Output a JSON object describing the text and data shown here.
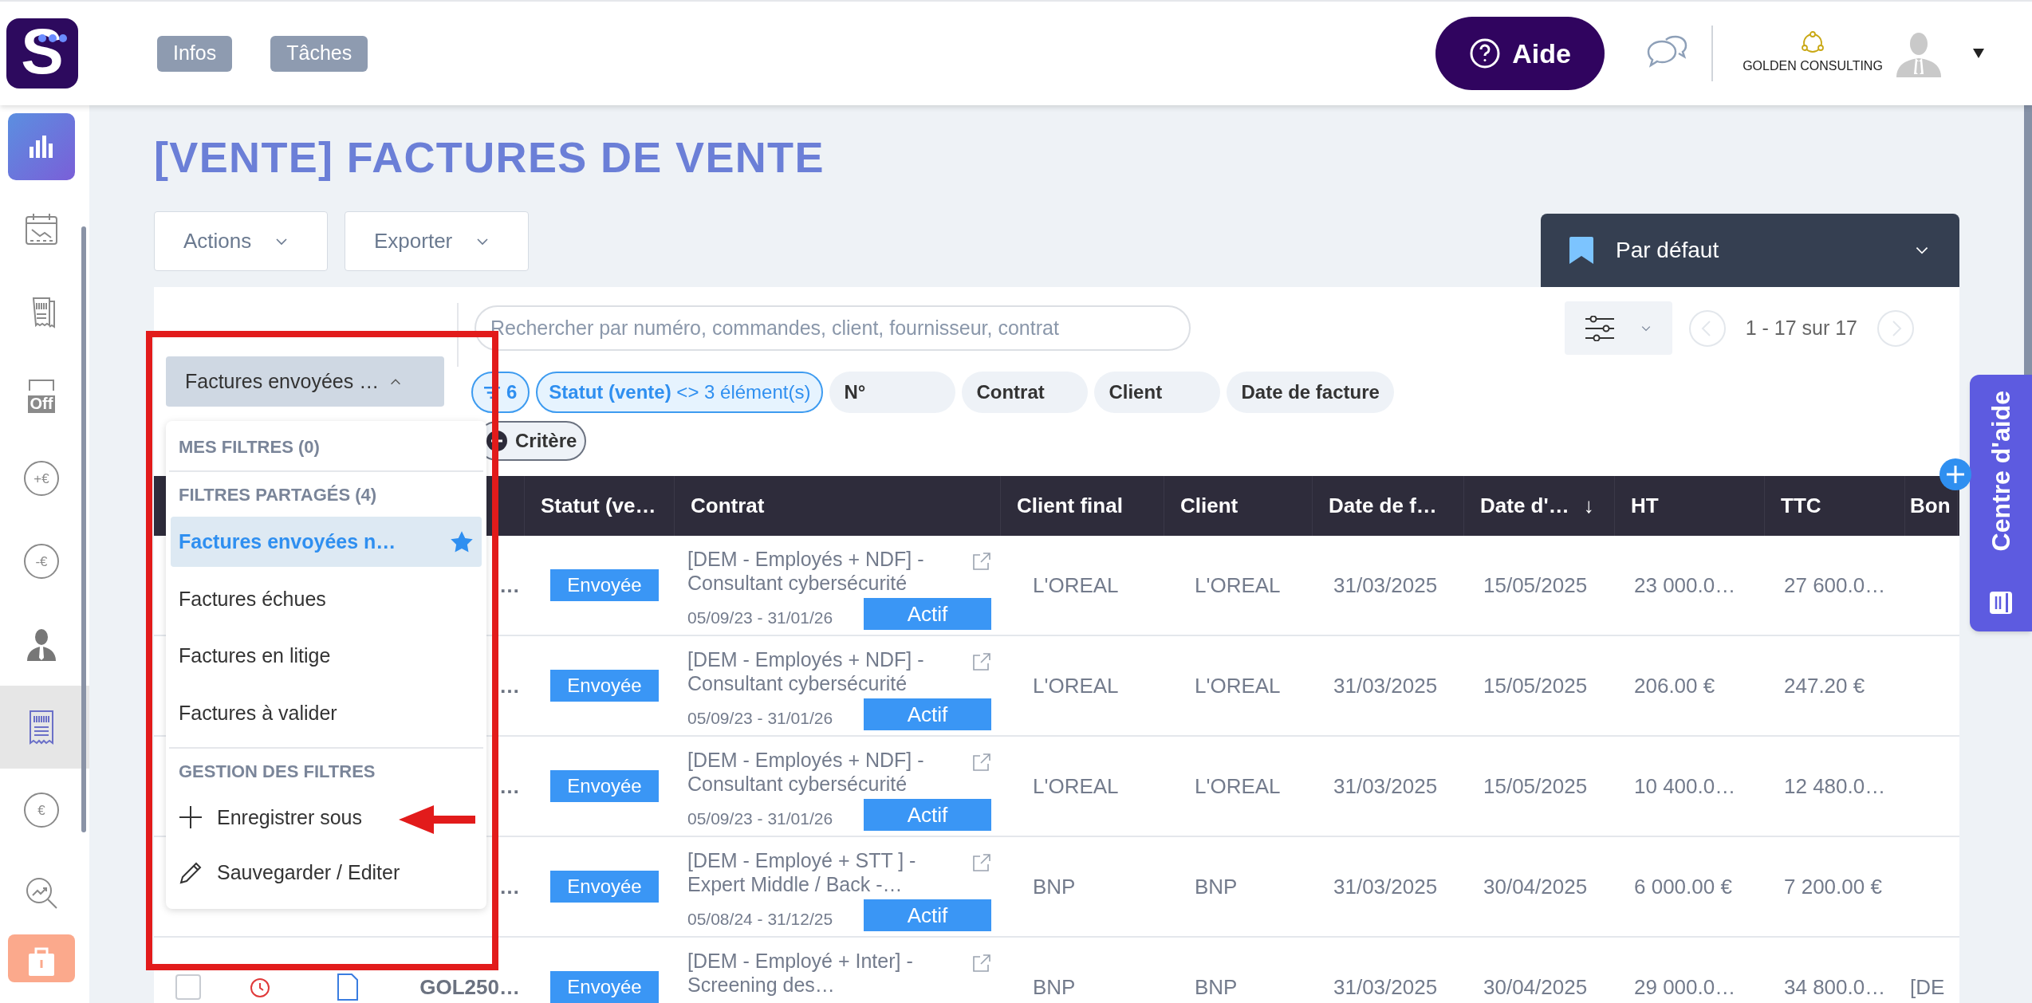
{
  "header": {
    "logo": {
      "letter": "S"
    },
    "nav_buttons": [
      "Infos",
      "Tâches"
    ],
    "help_button": "Aide",
    "company": "GOLDEN CONSULTING"
  },
  "sidebar": {
    "items": [
      {
        "kind": "chart",
        "selected": false
      },
      {
        "kind": "calendar",
        "selected": false
      },
      {
        "kind": "receipts",
        "selected": false
      },
      {
        "kind": "off",
        "label": "Off",
        "selected": false
      },
      {
        "kind": "plus-euro",
        "label": "+€",
        "selected": false
      },
      {
        "kind": "minus-euro",
        "label": "-€",
        "selected": false
      },
      {
        "kind": "person",
        "selected": false
      },
      {
        "kind": "invoice",
        "selected": true
      },
      {
        "kind": "coins",
        "label": "€",
        "selected": false
      },
      {
        "kind": "search-chart",
        "selected": false
      },
      {
        "kind": "briefcase",
        "selected": false
      }
    ]
  },
  "page_title": "[VENTE] FACTURES DE VENTE",
  "toolbar": {
    "buttons": [
      "Actions",
      "Exporter"
    ]
  },
  "view_selector": {
    "label": "Par défaut"
  },
  "filter_select": {
    "label": "Factures envoyées …",
    "expanded": true
  },
  "filter_menu": {
    "sections": [
      {
        "title": "MES FILTRES (0)"
      },
      {
        "title": "FILTRES PARTAGÉS (4)",
        "items": [
          {
            "label": "Factures envoyées n…",
            "selected": true,
            "favorite": true
          },
          {
            "label": "Factures échues",
            "selected": false,
            "favorite": false
          },
          {
            "label": "Factures en litige",
            "selected": false,
            "favorite": false
          },
          {
            "label": "Factures à valider",
            "selected": false,
            "favorite": false
          }
        ]
      },
      {
        "title": "GESTION DES FILTRES",
        "actions": [
          {
            "kind": "add",
            "label": "Enregistrer sous"
          },
          {
            "kind": "edit",
            "label": "Sauvegarder / Editer"
          }
        ]
      }
    ]
  },
  "search": {
    "placeholder": "Rechercher par numéro, commandes, client, fournisseur, contrat"
  },
  "pagination": {
    "text": "1 - 17 sur 17"
  },
  "filter_chips": [
    {
      "kind": "count",
      "label": "6"
    },
    {
      "kind": "active",
      "label": "**Statut (vente)** <> 3 élément(s)"
    },
    {
      "kind": "field",
      "label": "N°"
    },
    {
      "kind": "field",
      "label": "Contrat"
    },
    {
      "kind": "field",
      "label": "Client"
    },
    {
      "kind": "field",
      "label": "Date de facture"
    }
  ],
  "criterion_button": "Critère",
  "table": {
    "columns": [
      {
        "label": "Statut (ve…"
      },
      {
        "label": "Contrat"
      },
      {
        "label": "Client final"
      },
      {
        "label": "Client"
      },
      {
        "label": "Date de f…"
      },
      {
        "label": "Date d'…",
        "sort": "↓"
      },
      {
        "label": "HT"
      },
      {
        "label": "TTC"
      },
      {
        "label": "Bon"
      }
    ],
    "rows": [
      {
        "number": "…",
        "status": "Envoyée",
        "contract": {
          "title": "[DEM - Employés + NDF] - Consultant cybersécurité",
          "period": "05/09/23 - 31/01/26",
          "state": "Actif"
        },
        "client_final": "L'OREAL",
        "client": "L'OREAL",
        "invoice_date": "31/03/2025",
        "due_date": "15/05/2025",
        "ht": "23 000.0…",
        "ttc": "27 600.0…"
      },
      {
        "number": "…",
        "status": "Envoyée",
        "contract": {
          "title": "[DEM - Employés + NDF] - Consultant cybersécurité",
          "period": "05/09/23 - 31/01/26",
          "state": "Actif"
        },
        "client_final": "L'OREAL",
        "client": "L'OREAL",
        "invoice_date": "31/03/2025",
        "due_date": "15/05/2025",
        "ht": "206.00 €",
        "ttc": "247.20 €"
      },
      {
        "number": "…",
        "status": "Envoyée",
        "contract": {
          "title": "[DEM - Employés + NDF] - Consultant cybersécurité",
          "period": "05/09/23 - 31/01/26",
          "state": "Actif"
        },
        "client_final": "L'OREAL",
        "client": "L'OREAL",
        "invoice_date": "31/03/2025",
        "due_date": "15/05/2025",
        "ht": "10 400.0…",
        "ttc": "12 480.0…"
      },
      {
        "number": "…",
        "status": "Envoyée",
        "contract": {
          "title": "[DEM - Employé + STT ] - Expert Middle / Back -…",
          "period": "05/08/24 - 31/12/25",
          "state": "Actif"
        },
        "client_final": "BNP",
        "client": "BNP",
        "invoice_date": "31/03/2025",
        "due_date": "30/04/2025",
        "ht": "6 000.00 €",
        "ttc": "7 200.00 €"
      },
      {
        "leading": {
          "checked": false
        },
        "number": "GOL250…",
        "status": "Envoyée",
        "contract": {
          "title": "[DEM - Employé + Inter] - Screening des…"
        },
        "client_final": "BNP",
        "client": "BNP",
        "invoice_date": "31/03/2025",
        "due_date": "30/04/2025",
        "ht": "29 000.0…",
        "ttc": "34 800.0…",
        "bon": "[DE"
      }
    ]
  },
  "help_tab": {
    "label": "Centre d'aide"
  }
}
